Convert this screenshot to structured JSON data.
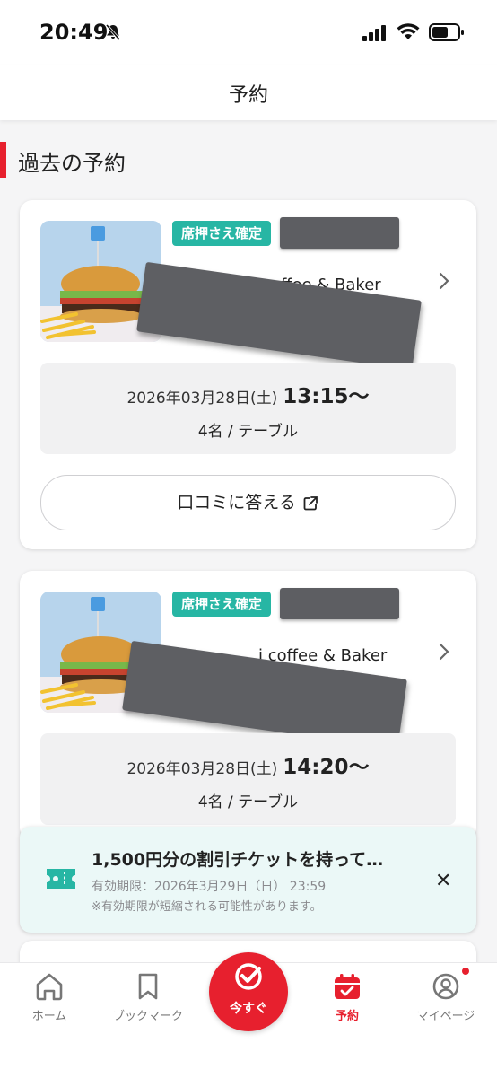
{
  "status_bar": {
    "time": "20:49"
  },
  "nav": {
    "title": "予約"
  },
  "section": {
    "title": "過去の予約"
  },
  "reservations": [
    {
      "badge": "席押さえ確定",
      "shop_name_visible": "offee & Baker",
      "date": "2026年03月28日(土)",
      "time": "13:15〜",
      "party": "4名 / テーブル",
      "review_button": "口コミに答える"
    },
    {
      "badge": "席押さえ確定",
      "shop_name_visible": "i coffee & Baker",
      "date": "2026年03月28日(土)",
      "time": "14:20〜",
      "party": "4名 / テーブル"
    }
  ],
  "coupon": {
    "title": "1,500円分の割引チケットを持って…",
    "expiry": "有効期限：2026年3月29日（日） 23:59",
    "note": "※有効期限が短縮される可能性があります。",
    "close_icon": "close-icon"
  },
  "tabbar": {
    "home": "ホーム",
    "bookmark": "ブックマーク",
    "now": "今すぐ",
    "reservations": "予約",
    "mypage": "マイページ"
  },
  "colors": {
    "accent": "#e7202e",
    "badge": "#27b6a4",
    "coupon_bg": "#ebf8f7",
    "redaction": "#5e5f63"
  }
}
